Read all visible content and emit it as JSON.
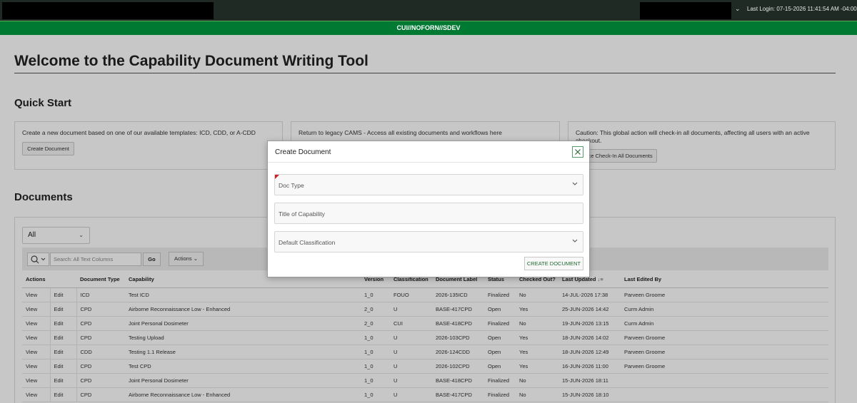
{
  "header": {
    "login_text": "Last Login: 07-15-2026 11:41:54 AM -04:00"
  },
  "banner": {
    "text": "CUI//NOFORN//SDEV"
  },
  "page": {
    "title": "Welcome to the Capability Document Writing Tool"
  },
  "quick_start": {
    "title": "Quick Start",
    "cards": [
      {
        "text": "Create a new document based on one of our available templates: ICD, CDD, or A-CDD",
        "button": "Create Document"
      },
      {
        "text": "Return to legacy CAMS - Access all existing documents and workflows here"
      },
      {
        "text": "Caution: This global action will check-in all documents, affecting all users with an active checkout.",
        "button": "Force Check-In All Documents"
      }
    ]
  },
  "documents": {
    "title": "Documents",
    "filter_value": "All",
    "search_placeholder": "Search: All Text Columns",
    "go_label": "Go",
    "actions_label": "Actions",
    "columns": [
      "Actions",
      "",
      "Document Type",
      "Capability",
      "Version",
      "Classification",
      "Document Label",
      "Status",
      "Checked Out?",
      "Last Updated",
      "Last Edited By"
    ],
    "rows": [
      [
        "View",
        "Edit",
        "ICD",
        "Test ICD",
        "1_0",
        "FOUO",
        "2026-135ICD",
        "Finalized",
        "No",
        "14-JUL-2026 17:38",
        "Parveen Groome"
      ],
      [
        "View",
        "Edit",
        "CPD",
        "Airborne Reconnaissance Low - Enhanced",
        "2_0",
        "U",
        "BASE-417CPD",
        "Open",
        "Yes",
        "25-JUN-2026 14:42",
        "Curm Admin"
      ],
      [
        "View",
        "Edit",
        "CPD",
        "Joint Personal Dosimeter",
        "2_0",
        "CUI",
        "BASE-418CPD",
        "Finalized",
        "No",
        "19-JUN-2026 13:15",
        "Curm Admin"
      ],
      [
        "View",
        "Edit",
        "CPD",
        "Testing Upload",
        "1_0",
        "U",
        "2026-103CPD",
        "Open",
        "Yes",
        "18-JUN-2026 14:02",
        "Parveen Groome"
      ],
      [
        "View",
        "Edit",
        "CDD",
        "Testing 1.1 Release",
        "1_0",
        "U",
        "2026-124CDD",
        "Open",
        "Yes",
        "18-JUN-2026 12:49",
        "Parveen Groome"
      ],
      [
        "View",
        "Edit",
        "CPD",
        "Test CPD",
        "1_0",
        "U",
        "2026-102CPD",
        "Open",
        "Yes",
        "16-JUN-2026 11:00",
        "Parveen Groome"
      ],
      [
        "View",
        "Edit",
        "CPD",
        "Joint Personal Dosimeter",
        "1_0",
        "U",
        "BASE-418CPD",
        "Finalized",
        "No",
        "15-JUN-2026 18:11",
        ""
      ],
      [
        "View",
        "Edit",
        "CPD",
        "Airborne Reconnaissance Low - Enhanced",
        "1_0",
        "U",
        "BASE-417CPD",
        "Finalized",
        "No",
        "15-JUN-2026 18:10",
        ""
      ]
    ]
  },
  "modal": {
    "title": "Create Document",
    "doc_type_label": "Doc Type",
    "title_label": "Title of Capability",
    "classification_label": "Default Classification",
    "create_button": "CREATE DOCUMENT"
  }
}
